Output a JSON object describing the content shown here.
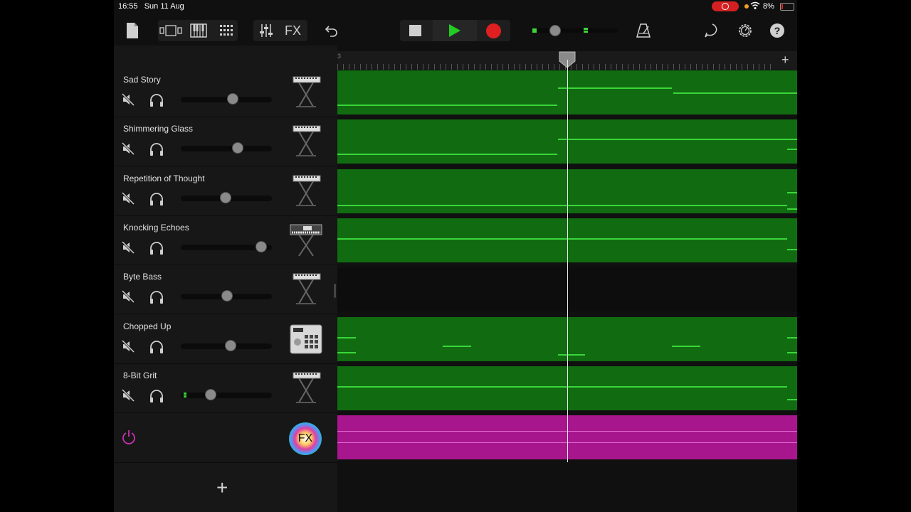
{
  "status": {
    "time": "16:55",
    "date": "Sun 11 Aug",
    "battery": "8%"
  },
  "toolbar": {
    "fx_label": "FX",
    "help": "?"
  },
  "tracks": [
    {
      "name": "Sad Story",
      "volume": 0.58,
      "instrument": "keyboard"
    },
    {
      "name": "Shimmering Glass",
      "volume": 0.64,
      "instrument": "keyboard"
    },
    {
      "name": "Repetition of Thought",
      "volume": 0.49,
      "instrument": "keyboard"
    },
    {
      "name": "Knocking Echoes",
      "volume": 0.94,
      "instrument": "synth-keyboard"
    },
    {
      "name": "Byte Bass",
      "volume": 0.51,
      "instrument": "keyboard"
    },
    {
      "name": "Chopped Up",
      "volume": 0.55,
      "instrument": "drum-machine"
    },
    {
      "name": "8-Bit Grit",
      "volume": 0.3,
      "instrument": "keyboard"
    }
  ],
  "fx_track": {
    "label": "FX"
  },
  "ruler": {
    "bar_label": "3"
  },
  "colors": {
    "region": "#116c11",
    "note": "#3ad63a",
    "fx_region": "#a8168e",
    "record": "#e02020",
    "play": "#22cc22"
  }
}
